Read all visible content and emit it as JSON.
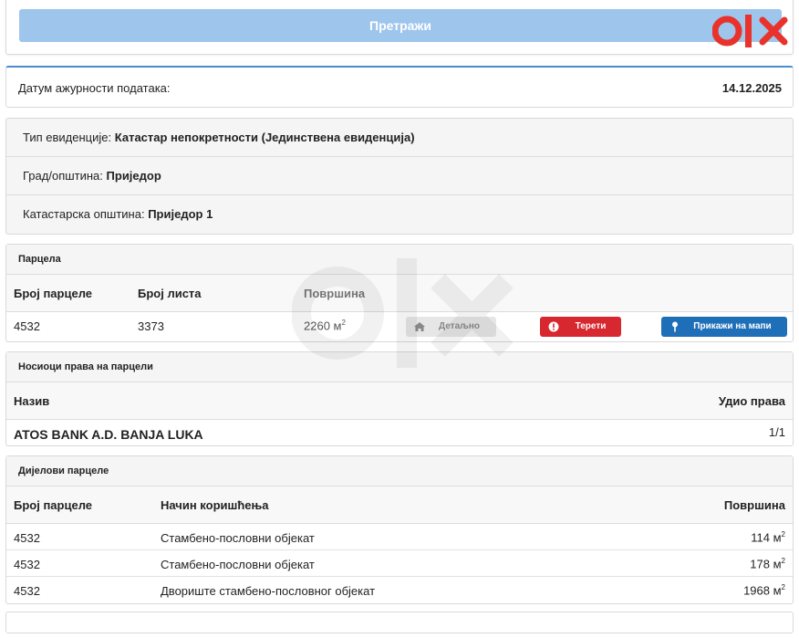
{
  "search": {
    "button_label": "Претражи"
  },
  "brand": {
    "logo_text": "olx",
    "accent": "#e8322b"
  },
  "update": {
    "label": "Датум ажурности података:",
    "date": "14.12.2025"
  },
  "record": {
    "type_label": "Тип евиденције:",
    "type_value": "Катастар непокретности (Јединствена евиденција)",
    "city_label": "Град/општина:",
    "city_value": "Приједор",
    "municipality_label": "Катастарска општина:",
    "municipality_value": "Приједор 1"
  },
  "parcel": {
    "title": "Парцела",
    "headers": {
      "number": "Број парцеле",
      "sheet": "Број листа",
      "area": "Површина"
    },
    "row": {
      "number": "4532",
      "sheet": "3373",
      "area": "2260",
      "unit": "м",
      "unit_sup": "2"
    },
    "buttons": {
      "details": "Детаљно",
      "burdens": "Терети",
      "map": "Прикажи на мапи"
    }
  },
  "holders": {
    "title": "Носиоци права на парцели",
    "headers": {
      "name": "Назив",
      "share": "Удио права"
    },
    "rows": [
      {
        "name": "ATOS BANK A.D. BANJA LUKA",
        "share": "1/1"
      }
    ]
  },
  "parts": {
    "title": "Дијелови парцеле",
    "headers": {
      "number": "Број парцеле",
      "use": "Начин коришћења",
      "area": "Површина"
    },
    "unit": "м",
    "unit_sup": "2",
    "rows": [
      {
        "number": "4532",
        "use": "Стамбено-пословни објекат",
        "area": "114"
      },
      {
        "number": "4532",
        "use": "Стамбено-пословни објекат",
        "area": "178"
      },
      {
        "number": "4532",
        "use": "Двориште стамбено-пословног објекат",
        "area": "1968"
      }
    ]
  },
  "colors": {
    "search_button": "#9ec5ec",
    "burdens_button": "#d7282f",
    "map_button": "#1f6fb8",
    "details_button": "#e6e6e6"
  }
}
